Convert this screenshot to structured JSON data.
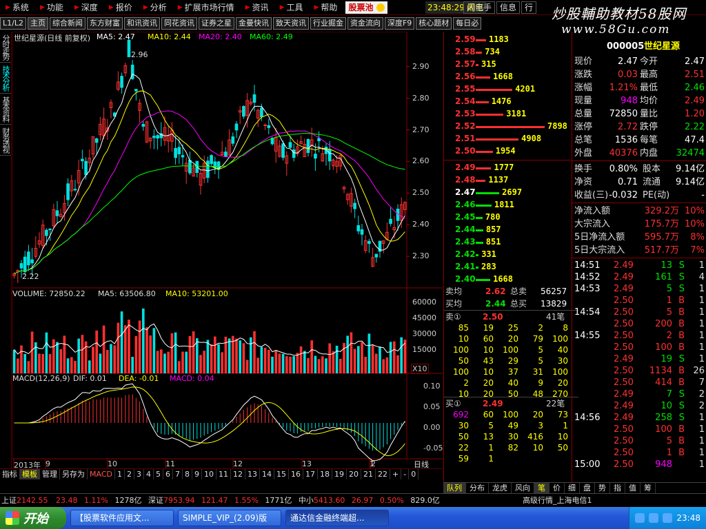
{
  "menu": {
    "items": [
      "系统",
      "功能",
      "深度",
      "报价",
      "分析",
      "扩展市场行情",
      "资讯",
      "工具",
      "帮助"
    ],
    "stock_pool": "股票池",
    "clock": "23:48:29 周三",
    "right_items": [
      "闪电手",
      "信息",
      "行"
    ]
  },
  "watermark": {
    "line1": "炒股輔助教材58股网",
    "line2": "www.58Gu.com"
  },
  "tabs": {
    "level": "L1/L2",
    "items": [
      "主页",
      "综合新闻",
      "东方财富",
      "和讯资讯",
      "同花资讯",
      "证券之星",
      "金曼快讯",
      "致天资讯",
      "行业掘金",
      "资金流向",
      "深度F9",
      "核心题材",
      "每日必"
    ]
  },
  "sidebar": [
    "分时走势",
    "技术分析",
    "基本资料",
    "财务透视"
  ],
  "chart": {
    "title": "世纪星源(日线 前复权)",
    "ma": [
      {
        "label": "MA5: 2.47",
        "color": "#ffffff"
      },
      {
        "label": "MA10: 2.44",
        "color": "#ffff00"
      },
      {
        "label": "MA20: 2.40",
        "color": "#ff00ff"
      },
      {
        "label": "MA60: 2.49",
        "color": "#00ff00"
      }
    ],
    "price_ticks": [
      "2.90",
      "2.80",
      "2.70",
      "2.60",
      "2.50",
      "2.40",
      "2.30"
    ],
    "high_label": "2.96",
    "low_label": "2.22",
    "volume_title": "VOLUME: 72850.22",
    "vol_ma5": "MA5: 63506.80",
    "vol_ma10": "MA10: 53201.00",
    "vol_ticks": [
      "60000",
      "45000",
      "30000",
      "15000"
    ],
    "vol_unit": "X10",
    "macd_title": "MACD(12,26,9)",
    "macd_dif": "DIF: 0.01",
    "macd_dea": "DEA: -0.01",
    "macd_val": "MACD: 0.04",
    "macd_ticks": [
      "0.10",
      "0.05",
      "0.00",
      "-0.05"
    ],
    "date_labels": [
      "2013年",
      "9",
      "10",
      "11",
      "12",
      "13",
      "1",
      "2"
    ],
    "period": "日线",
    "bottom_tabs": [
      "指标",
      "模板",
      "管理",
      "另存为",
      "MACD",
      "1",
      "2",
      "3",
      "4",
      "5",
      "6",
      "7",
      "8",
      "9",
      "10",
      "11",
      "12",
      "13",
      "14",
      "15",
      "16",
      "17",
      "18",
      "19",
      "20",
      "21",
      "22",
      "+",
      "-",
      "0"
    ]
  },
  "orderbook": {
    "sell": [
      {
        "price": "2.59",
        "vol": "1183"
      },
      {
        "price": "2.58",
        "vol": "734"
      },
      {
        "price": "2.57",
        "vol": "315"
      },
      {
        "price": "2.56",
        "vol": "1668"
      },
      {
        "price": "2.55",
        "vol": "4201"
      },
      {
        "price": "2.54",
        "vol": "1476"
      },
      {
        "price": "2.53",
        "vol": "3181"
      },
      {
        "price": "2.52",
        "vol": "7898"
      },
      {
        "price": "2.51",
        "vol": "4908"
      },
      {
        "price": "2.50",
        "vol": "1954"
      }
    ],
    "buy": [
      {
        "price": "2.49",
        "vol": "1777"
      },
      {
        "price": "2.48",
        "vol": "1137"
      },
      {
        "price": "2.47",
        "vol": "2697"
      },
      {
        "price": "2.46",
        "vol": "1811"
      },
      {
        "price": "2.45",
        "vol": "780"
      },
      {
        "price": "2.44",
        "vol": "857"
      },
      {
        "price": "2.43",
        "vol": "851"
      },
      {
        "price": "2.42",
        "vol": "331"
      },
      {
        "price": "2.41",
        "vol": "283"
      },
      {
        "price": "2.40",
        "vol": "1668"
      }
    ]
  },
  "summary": {
    "avg_sell_label": "卖均",
    "avg_sell": "2.62",
    "total_sell_label": "总卖",
    "total_sell": "56257",
    "avg_buy_label": "买均",
    "avg_buy": "2.44",
    "total_buy_label": "总买",
    "total_buy": "13829"
  },
  "queue": {
    "sell_label": "卖①",
    "sell_price": "2.50",
    "sell_count": "41笔",
    "sell_rows": [
      [
        "85",
        "19",
        "25",
        "2",
        "8"
      ],
      [
        "10",
        "60",
        "20",
        "79",
        "100"
      ],
      [
        "100",
        "10",
        "100",
        "5",
        "40"
      ],
      [
        "50",
        "43",
        "29",
        "5",
        "30"
      ],
      [
        "100",
        "10",
        "37",
        "31",
        "100"
      ],
      [
        "2",
        "20",
        "40",
        "9",
        "20"
      ],
      [
        "10",
        "20",
        "50",
        "48",
        "270"
      ]
    ],
    "buy_label": "买①",
    "buy_price": "2.49",
    "buy_count": "22笔",
    "buy_rows": [
      [
        "692",
        "60",
        "100",
        "20",
        "73"
      ],
      [
        "30",
        "5",
        "49",
        "3",
        "1"
      ],
      [
        "50",
        "13",
        "30",
        "416",
        "10"
      ],
      [
        "22",
        "1",
        "82",
        "10",
        "50"
      ],
      [
        "59",
        "1",
        "",
        "",
        ""
      ]
    ]
  },
  "quote": {
    "code": "000005",
    "name": "世纪星源",
    "rows": [
      {
        "l1": "现价",
        "v1": "2.47",
        "l2": "今开",
        "v2": "2.47",
        "c1": "#ffffff",
        "c2": "#ffffff"
      },
      {
        "l1": "涨跌",
        "v1": "0.03",
        "l2": "最高",
        "v2": "2.51",
        "c1": "#ff3030",
        "c2": "#ff3030"
      },
      {
        "l1": "涨幅",
        "v1": "1.21%",
        "l2": "最低",
        "v2": "2.46",
        "c1": "#ff3030",
        "c2": "#00e000"
      },
      {
        "l1": "现量",
        "v1": "948",
        "l2": "均价",
        "v2": "2.49",
        "c1": "#ff00ff",
        "c2": "#ff3030"
      },
      {
        "l1": "总量",
        "v1": "72850",
        "l2": "量比",
        "v2": "1.20",
        "c1": "#ffffff",
        "c2": "#ff3030"
      },
      {
        "l1": "涨停",
        "v1": "2.72",
        "l2": "跌停",
        "v2": "2.22",
        "c1": "#ff3030",
        "c2": "#00e000"
      },
      {
        "l1": "总笔",
        "v1": "1536",
        "l2": "每笔",
        "v2": "47.4",
        "c1": "#ffffff",
        "c2": "#ffffff"
      },
      {
        "l1": "外盘",
        "v1": "40376",
        "l2": "内盘",
        "v2": "32474",
        "c1": "#ff3030",
        "c2": "#00e000"
      }
    ],
    "rows2": [
      {
        "l1": "换手",
        "v1": "0.80%",
        "l2": "股本",
        "v2": "9.14亿"
      },
      {
        "l1": "净资",
        "v1": "0.71",
        "l2": "流通",
        "v2": "9.14亿"
      },
      {
        "l1": "收益(三)",
        "v1": "-0.032",
        "l2": "PE(动)",
        "v2": "-"
      }
    ],
    "flows": [
      {
        "label": "净流入额",
        "val": "329.2万",
        "pct": "10%"
      },
      {
        "label": "大宗流入",
        "val": "175.7万",
        "pct": "10%"
      },
      {
        "label": "5日净流入额",
        "val": "595.7万",
        "pct": "8%"
      },
      {
        "label": "5日大宗流入",
        "val": "517.7万",
        "pct": "7%"
      }
    ]
  },
  "ticks": [
    {
      "t": "14:51",
      "p": "2.49",
      "v": "13",
      "s": "S",
      "n": "1"
    },
    {
      "t": "14:52",
      "p": "2.49",
      "v": "161",
      "s": "S",
      "n": "4"
    },
    {
      "t": "14:53",
      "p": "2.49",
      "v": "5",
      "s": "S",
      "n": "1"
    },
    {
      "t": "",
      "p": "2.50",
      "v": "1",
      "s": "B",
      "n": "1"
    },
    {
      "t": "14:54",
      "p": "2.50",
      "v": "5",
      "s": "B",
      "n": "1"
    },
    {
      "t": "",
      "p": "2.50",
      "v": "200",
      "s": "B",
      "n": "1"
    },
    {
      "t": "14:55",
      "p": "2.50",
      "v": "2",
      "s": "B",
      "n": "1"
    },
    {
      "t": "",
      "p": "2.50",
      "v": "100",
      "s": "B",
      "n": "1"
    },
    {
      "t": "",
      "p": "2.49",
      "v": "19",
      "s": "S",
      "n": "1"
    },
    {
      "t": "",
      "p": "2.50",
      "v": "1134",
      "s": "B",
      "n": "26"
    },
    {
      "t": "",
      "p": "2.50",
      "v": "414",
      "s": "B",
      "n": "7"
    },
    {
      "t": "",
      "p": "2.49",
      "v": "7",
      "s": "S",
      "n": "2"
    },
    {
      "t": "",
      "p": "2.49",
      "v": "10",
      "s": "S",
      "n": "2"
    },
    {
      "t": "14:56",
      "p": "2.49",
      "v": "258",
      "s": "S",
      "n": "1"
    },
    {
      "t": "",
      "p": "2.50",
      "v": "100",
      "s": "B",
      "n": "1"
    },
    {
      "t": "",
      "p": "2.50",
      "v": "5",
      "s": "B",
      "n": "1"
    },
    {
      "t": "",
      "p": "2.50",
      "v": "1",
      "s": "B",
      "n": "1"
    },
    {
      "t": "15:00",
      "p": "2.50",
      "v": "948",
      "s": "",
      "n": "1"
    }
  ],
  "right_tabs": [
    "队列",
    "分布",
    "龙虎",
    "风向",
    "笔",
    "价",
    "细",
    "盘",
    "势",
    "指",
    "值",
    "筹"
  ],
  "status": {
    "sh_label": "上证",
    "sh_val": "2142.55",
    "sh_chg": "23.48",
    "sh_pct": "1.11%",
    "sh_amt": "1278亿",
    "sz_label": "深证",
    "sz_val": "7953.94",
    "sz_chg": "121.47",
    "sz_pct": "1.55%",
    "sz_amt": "1771亿",
    "zx_label": "中小",
    "zx_val": "5413.60",
    "zx_chg": "26.97",
    "zx_pct": "0.50%",
    "zx_amt": "829.0亿",
    "server": "高级行情_上海电信1"
  },
  "taskbar": {
    "start": "开始",
    "tasks": [
      "【股票软件应用文...",
      "SIMPLE_VIP_(2.09)版",
      "通达信金融终端超..."
    ],
    "time": "23:48"
  },
  "colors": {
    "up": "#ff3030",
    "down": "#00e0e0",
    "ma5": "#ffffff",
    "ma10": "#ffff00",
    "ma20": "#ff00ff",
    "ma60": "#00ff00"
  }
}
